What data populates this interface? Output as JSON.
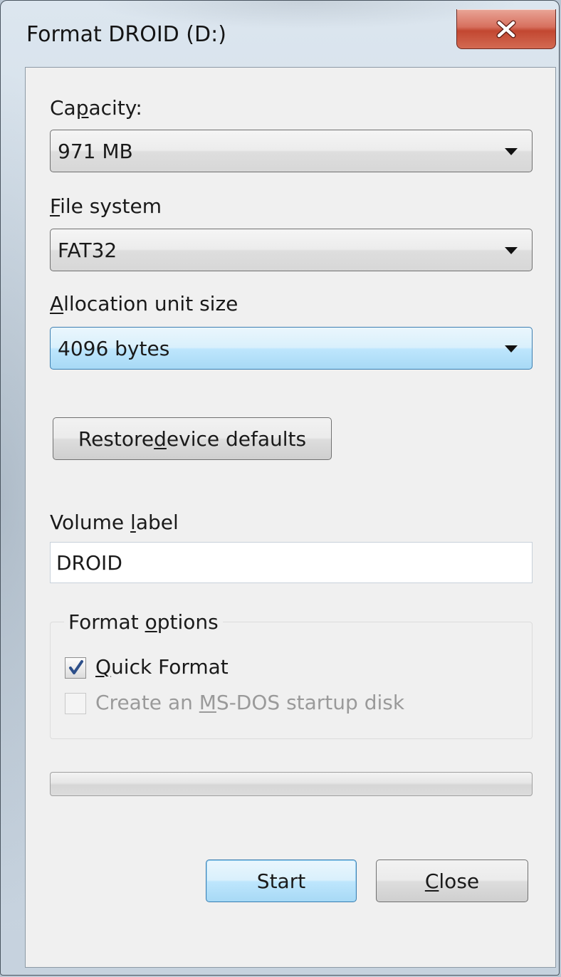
{
  "window": {
    "title": "Format DROID (D:)",
    "close_icon": "close-x-icon"
  },
  "capacity": {
    "label_pre": "Ca",
    "label_key": "p",
    "label_post": "acity:",
    "value": "971 MB"
  },
  "file_system": {
    "label_key": "F",
    "label_post": "ile system",
    "value": "FAT32"
  },
  "allocation": {
    "label_key": "A",
    "label_post": "llocation unit size",
    "value": "4096 bytes"
  },
  "restore_button": {
    "label_pre": "Restore ",
    "label_key": "d",
    "label_post": "evice defaults"
  },
  "volume_label": {
    "label_pre": "Volume ",
    "label_key": "l",
    "label_post": "abel",
    "value": "DROID"
  },
  "format_options": {
    "title_pre": "Format ",
    "title_key": "o",
    "title_post": "ptions",
    "quick_format": {
      "label_key": "Q",
      "label_post": "uick Format",
      "checked": true
    },
    "msdos_disk": {
      "label_pre": "Create an ",
      "label_key": "M",
      "label_post": "S-DOS startup disk",
      "checked": false,
      "enabled": false
    }
  },
  "progress": {
    "fraction": 0
  },
  "buttons": {
    "start_label": "Start",
    "close_key": "C",
    "close_post": "lose"
  },
  "colors": {
    "focus_blue": "#3c7fb1",
    "close_red": "#c24731",
    "progress_green": "#06b025"
  }
}
